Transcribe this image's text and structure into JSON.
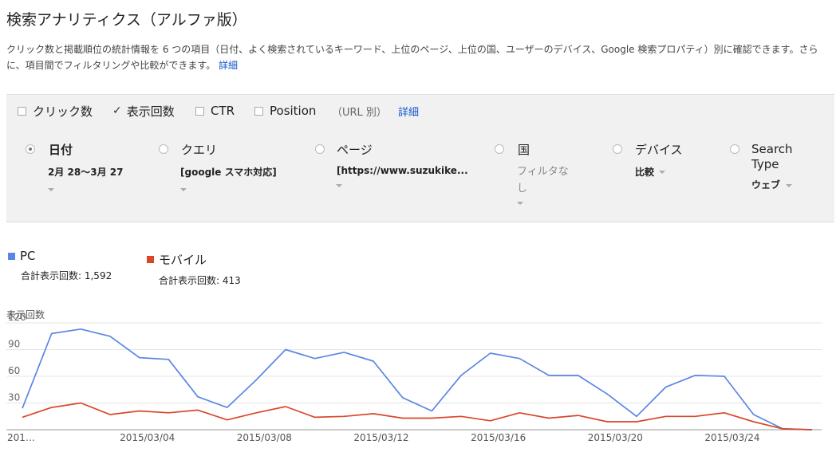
{
  "page_title": "検索アナリティクス（アルファ版）",
  "description": "クリック数と掲載順位の統計情報を 6 つの項目（日付、よく検索されているキーワード、上位のページ、上位の国、ユーザーのデバイス、Google 検索プロパティ）別に確認できます。さらに、項目間でフィルタリングや比較ができます。",
  "description_link": "詳細",
  "metrics": {
    "clicks": {
      "label": "クリック数",
      "checked": false
    },
    "impressions": {
      "label": "表示回数",
      "checked": true
    },
    "ctr": {
      "label": "CTR",
      "checked": false
    },
    "position": {
      "label": "Position",
      "checked": false
    },
    "url_note": "（URL 別）",
    "details_link": "詳細"
  },
  "dimensions": {
    "date": {
      "label": "日付",
      "value": "2月 28～3月 27",
      "selected": true
    },
    "query": {
      "label": "クエリ",
      "value": "[google スマホ対応]"
    },
    "page": {
      "label": "ページ",
      "value": "[https://www.suzukike..."
    },
    "country": {
      "label": "国",
      "value_line1": "フィルタな",
      "value_line2": "し"
    },
    "device": {
      "label": "デバイス",
      "value": "比較"
    },
    "search_type": {
      "label_line1": "Search",
      "label_line2": "Type",
      "value": "ウェブ"
    }
  },
  "legend": {
    "pc": {
      "name": "PC",
      "total": "合計表示回数: 1,592",
      "color": "#5b86e5"
    },
    "mobile": {
      "name": "モバイル",
      "total": "合計表示回数: 413",
      "color": "#d9472b"
    }
  },
  "chart_data": {
    "type": "line",
    "ylabel": "表示回数",
    "ylim": [
      0,
      120
    ],
    "yticks": [
      30,
      60,
      90,
      120
    ],
    "x_tick_labels": [
      "201…",
      "2015/03/04",
      "2015/03/08",
      "2015/03/12",
      "2015/03/16",
      "2015/03/20",
      "2015/03/24"
    ],
    "x": [
      "2015/02/28",
      "2015/03/01",
      "2015/03/02",
      "2015/03/03",
      "2015/03/04",
      "2015/03/05",
      "2015/03/06",
      "2015/03/07",
      "2015/03/08",
      "2015/03/09",
      "2015/03/10",
      "2015/03/11",
      "2015/03/12",
      "2015/03/13",
      "2015/03/14",
      "2015/03/15",
      "2015/03/16",
      "2015/03/17",
      "2015/03/18",
      "2015/03/19",
      "2015/03/20",
      "2015/03/21",
      "2015/03/22",
      "2015/03/23",
      "2015/03/24",
      "2015/03/25",
      "2015/03/26",
      "2015/03/27"
    ],
    "series": [
      {
        "name": "PC",
        "values": [
          24,
          108,
          113,
          105,
          81,
          79,
          37,
          25,
          56,
          90,
          80,
          87,
          77,
          36,
          21,
          61,
          86,
          80,
          61,
          61,
          40,
          15,
          48,
          61,
          60,
          17,
          1,
          0
        ]
      },
      {
        "name": "モバイル",
        "values": [
          14,
          25,
          30,
          17,
          21,
          19,
          22,
          11,
          19,
          26,
          14,
          15,
          18,
          13,
          13,
          15,
          10,
          19,
          13,
          16,
          9,
          9,
          15,
          15,
          19,
          9,
          1,
          0
        ]
      }
    ]
  }
}
